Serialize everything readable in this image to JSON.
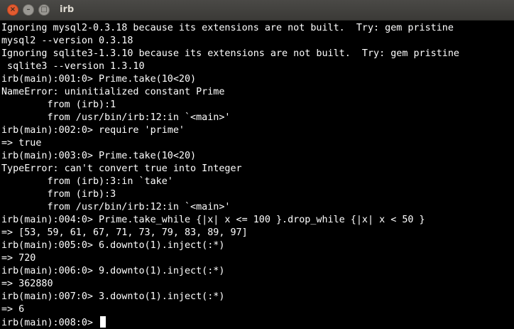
{
  "window": {
    "title": "irb",
    "controls": {
      "close": "×",
      "minimize": "–",
      "maximize": "□"
    }
  },
  "terminal": {
    "lines": [
      "Ignoring mysql2-0.3.18 because its extensions are not built.  Try: gem pristine",
      "mysql2 --version 0.3.18",
      "Ignoring sqlite3-1.3.10 because its extensions are not built.  Try: gem pristine",
      " sqlite3 --version 1.3.10",
      "irb(main):001:0> Prime.take(10<20)",
      "NameError: uninitialized constant Prime",
      "        from (irb):1",
      "        from /usr/bin/irb:12:in `<main>'",
      "irb(main):002:0> require 'prime'",
      "=> true",
      "irb(main):003:0> Prime.take(10<20)",
      "TypeError: can't convert true into Integer",
      "        from (irb):3:in `take'",
      "        from (irb):3",
      "        from /usr/bin/irb:12:in `<main>'",
      "irb(main):004:0> Prime.take_while {|x| x <= 100 }.drop_while {|x| x < 50 }",
      "=> [53, 59, 61, 67, 71, 73, 79, 83, 89, 97]",
      "irb(main):005:0> 6.downto(1).inject(:*)",
      "=> 720",
      "irb(main):006:0> 9.downto(1).inject(:*)",
      "=> 362880",
      "irb(main):007:0> 3.downto(1).inject(:*)",
      "=> 6"
    ],
    "prompt": "irb(main):008:0> "
  },
  "colors": {
    "background": "#000000",
    "foreground": "#ffffff",
    "close_button": "#e25b30",
    "titlebar": "#3c3b37"
  }
}
